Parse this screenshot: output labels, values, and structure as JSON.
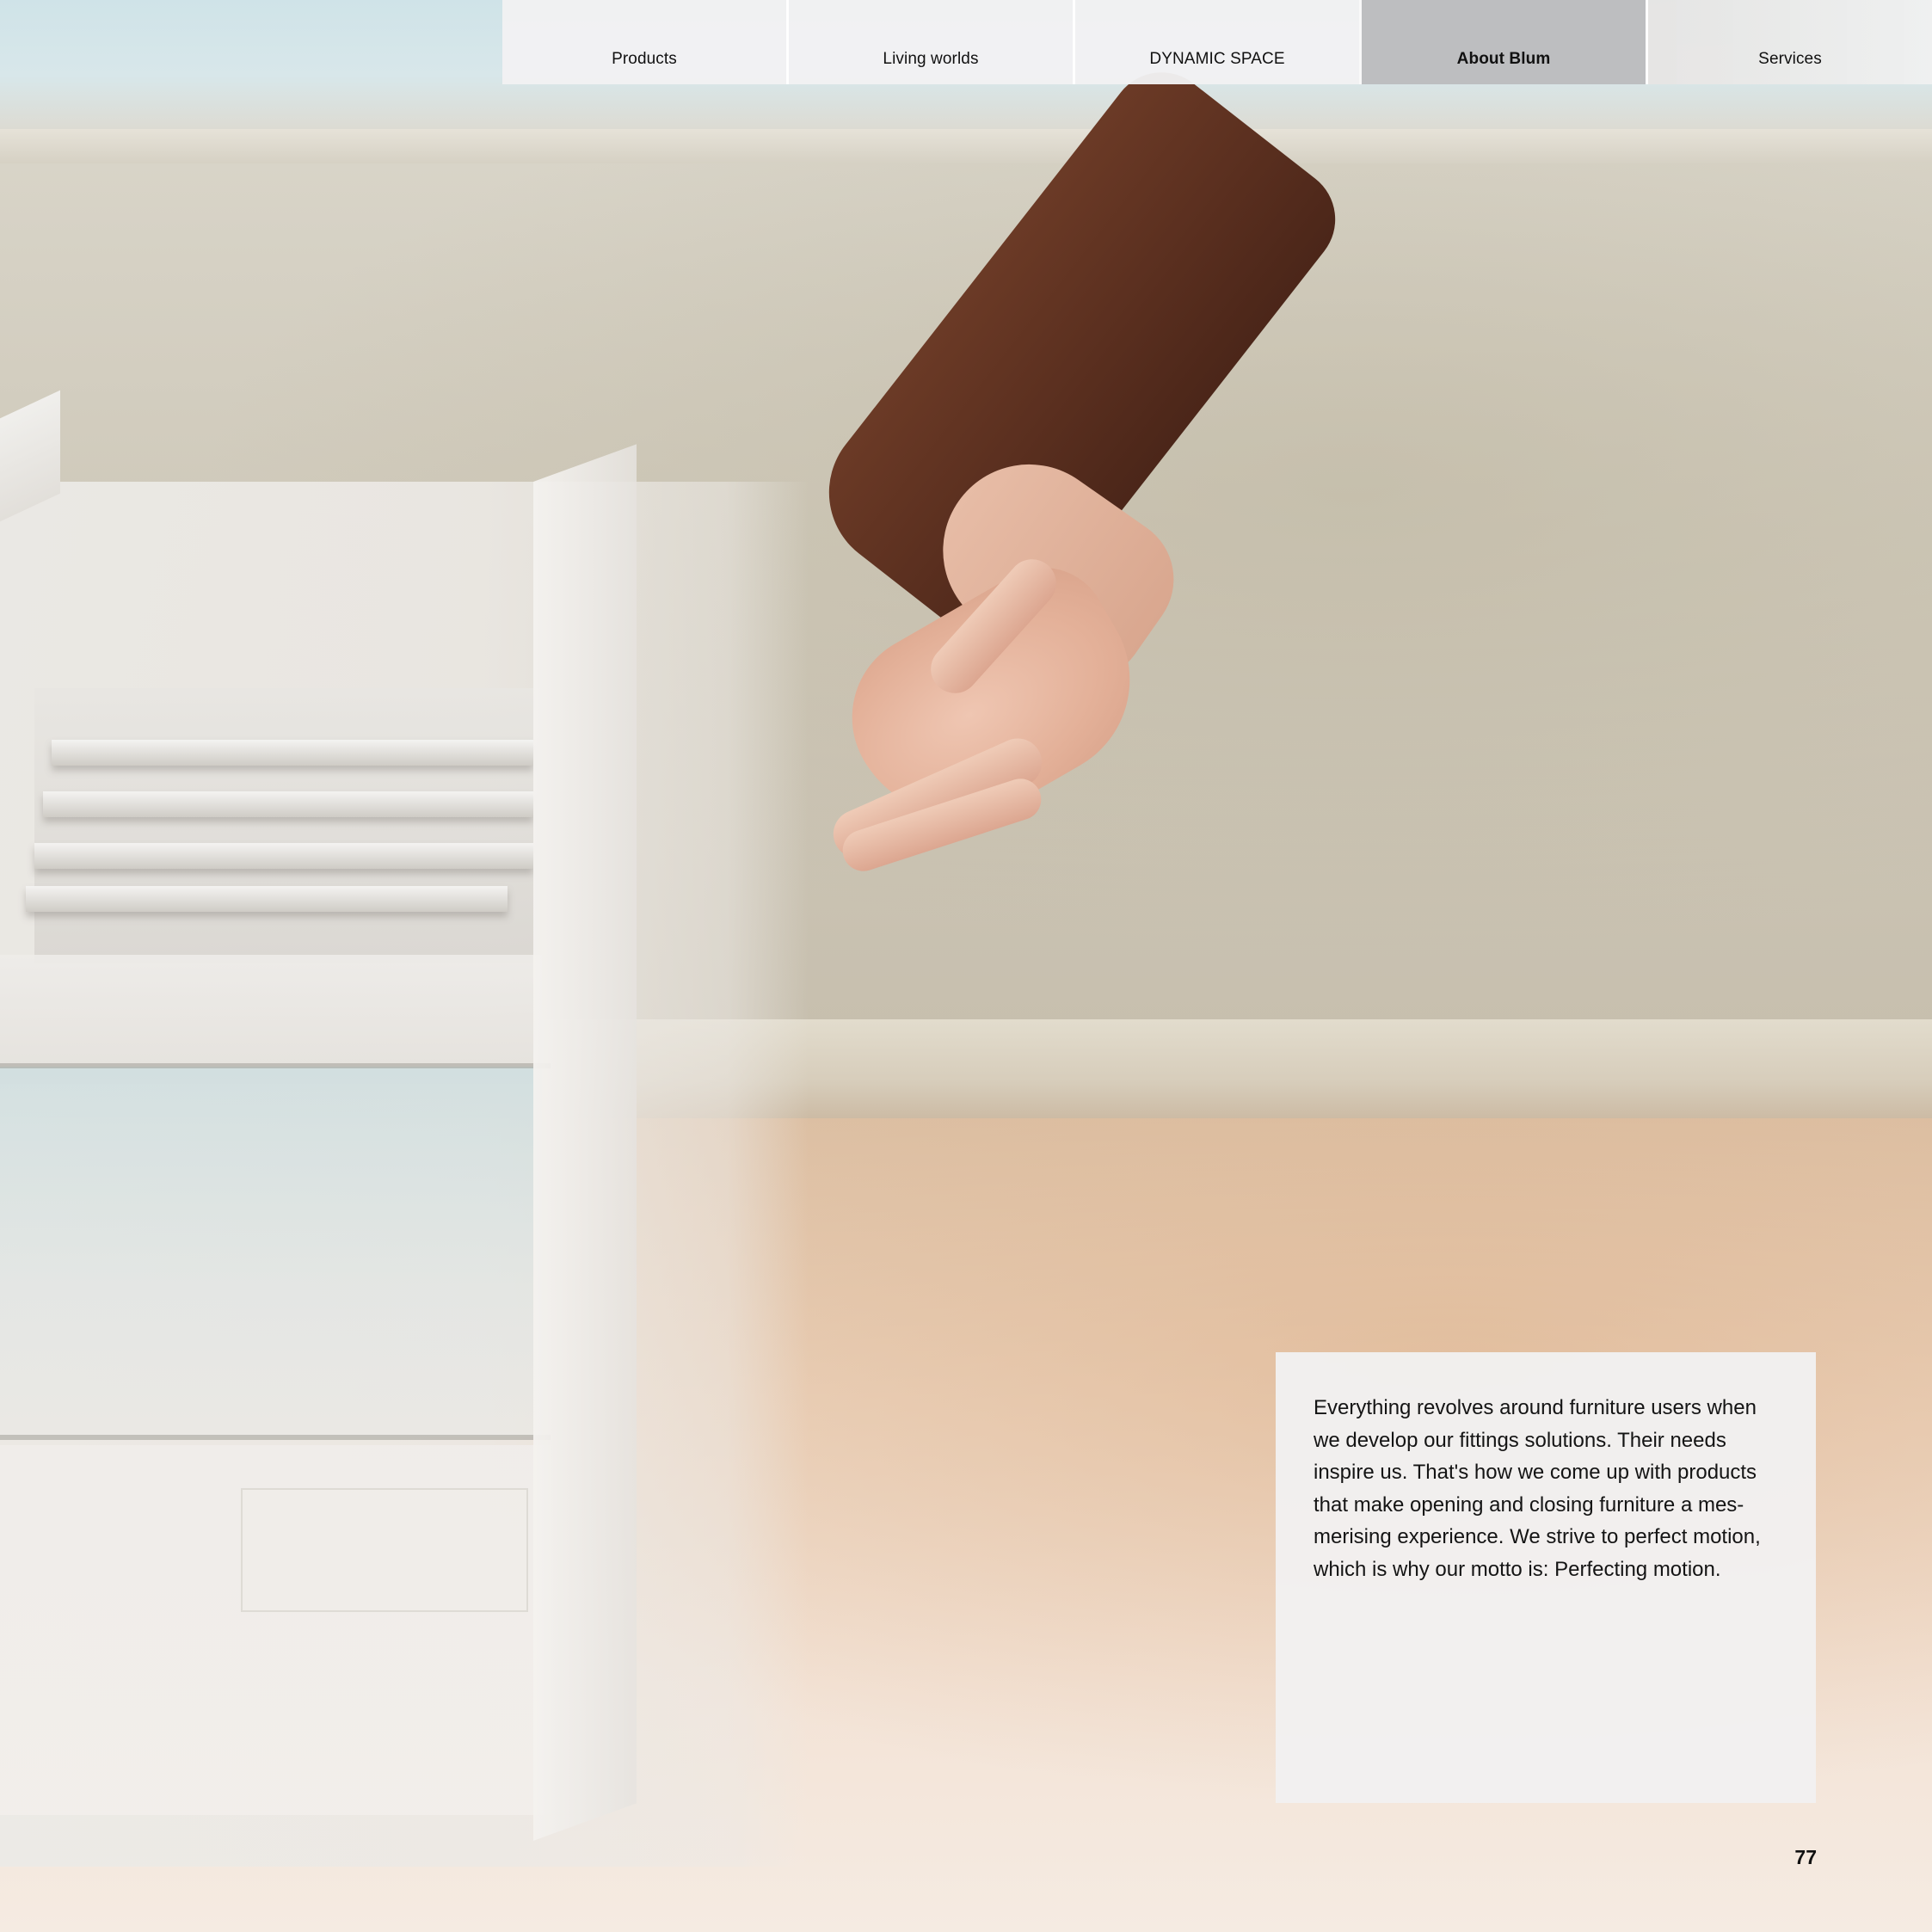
{
  "nav": {
    "tabs": [
      {
        "label": "Products"
      },
      {
        "label": "Living worlds"
      },
      {
        "label": "DYNAMIC SPACE"
      },
      {
        "label": "About Blum",
        "active": true
      },
      {
        "label": "Services"
      }
    ]
  },
  "body_text": "Everything revolves around furniture users when\nwe develop our fittings solutions. Their needs\ninspire us. That's how we come up with products\nthat make opening and closing furniture a mes-\nmerising experience. We strive to perfect motion,\nwhich is why our motto is: Perfecting motion.",
  "page_number": "77",
  "colors": {
    "active_tab": "#bdbec0",
    "tab": "#f1f1f2",
    "card": "#f1f0f0"
  }
}
